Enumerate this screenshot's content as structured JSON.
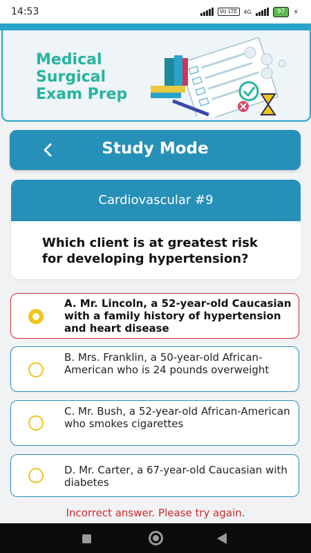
{
  "status_bar": {
    "time": "14:53",
    "network_label": "Vo LTE",
    "signal_label": "4G",
    "battery_level": "97"
  },
  "header": {
    "app_title": "Medical Surgical Exam Prep",
    "illustration": "exam-illustration-icon"
  },
  "study_bar": {
    "back_icon": "chevron-left-icon",
    "title": "Study Mode"
  },
  "question": {
    "category": "Cardiovascular #9",
    "text": "Which client is at greatest risk for developing hypertension?"
  },
  "options": [
    {
      "label": "A. Mr. Lincoln, a 52-year-old Caucasian with a family history of hypertension and heart disease",
      "selected": true
    },
    {
      "label": "B. Mrs. Franklin, a 50-year-old African-American who is 24 pounds overweight",
      "selected": false
    },
    {
      "label": "C. Mr. Bush, a 52-year-old African-American who smokes cigarettes",
      "selected": false
    },
    {
      "label": "D. Mr. Carter, a 67-year-old Caucasian with diabetes",
      "selected": false
    }
  ],
  "feedback": "Incorrect answer. Please try again.",
  "colors": {
    "primary": "#2790b8",
    "title_green": "#27b4a0",
    "error": "#cc2b2b",
    "radio": "#f0c419"
  }
}
